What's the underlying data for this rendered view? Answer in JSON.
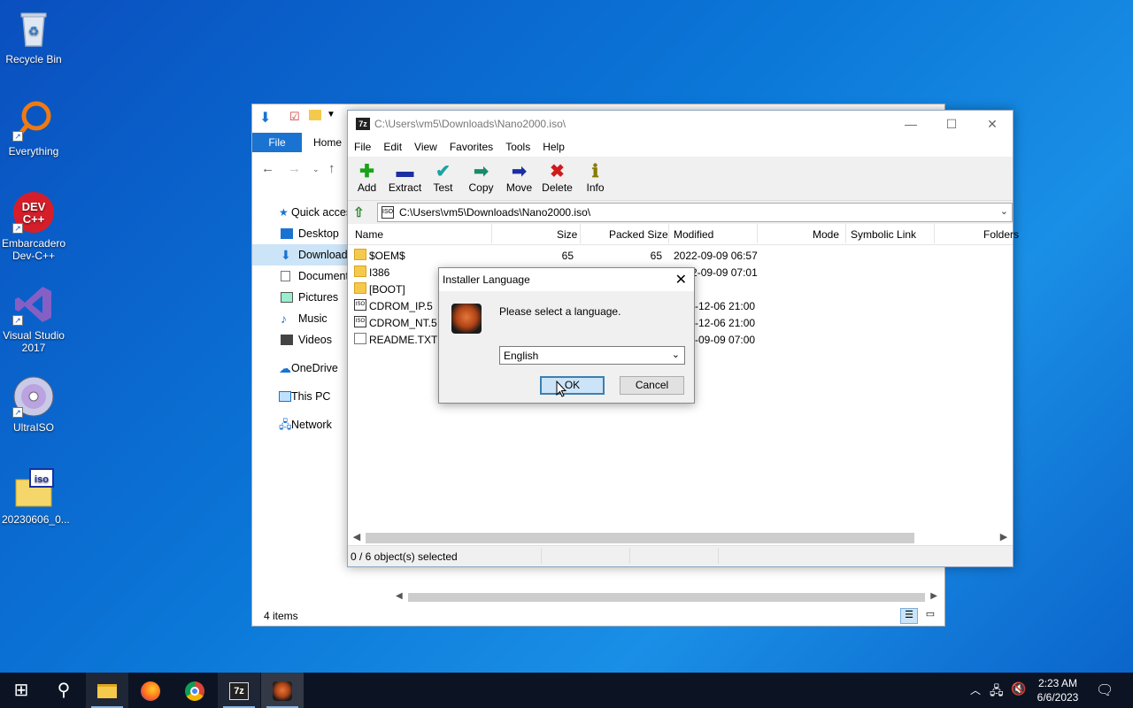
{
  "desktop": {
    "icons": [
      {
        "label": "Recycle Bin",
        "icon": "recycle-bin-icon"
      },
      {
        "label": "Everything",
        "icon": "magnifier-icon"
      },
      {
        "label": "Embarcadero Dev-C++",
        "icon": "devcpp-icon",
        "badge": "DEV C++"
      },
      {
        "label": "Visual Studio 2017",
        "icon": "visual-studio-icon"
      },
      {
        "label": "UltraISO",
        "icon": "disc-icon"
      },
      {
        "label": "20230606_0...",
        "icon": "iso-file-icon",
        "badge": "iso"
      }
    ]
  },
  "explorer": {
    "file_tab": "File",
    "home_tab": "Home",
    "sidebar": [
      {
        "label": "Quick access"
      },
      {
        "label": "Desktop"
      },
      {
        "label": "Downloads"
      },
      {
        "label": "Documents"
      },
      {
        "label": "Pictures"
      },
      {
        "label": "Music"
      },
      {
        "label": "Videos"
      },
      {
        "label": "OneDrive"
      },
      {
        "label": "This PC"
      },
      {
        "label": "Network"
      }
    ],
    "status": "4 items"
  },
  "sevenzip": {
    "logo": "7z",
    "title": "C:\\Users\\vm5\\Downloads\\Nano2000.iso\\",
    "menu": [
      "File",
      "Edit",
      "View",
      "Favorites",
      "Tools",
      "Help"
    ],
    "toolbar": [
      {
        "label": "Add",
        "glyph": "✚",
        "color": "#1aa31a"
      },
      {
        "label": "Extract",
        "glyph": "▬",
        "color": "#1b2fa3"
      },
      {
        "label": "Test",
        "glyph": "✔",
        "color": "#1aa3a3"
      },
      {
        "label": "Copy",
        "glyph": "➡",
        "color": "#1a8a6a"
      },
      {
        "label": "Move",
        "glyph": "➡",
        "color": "#1b2fa3"
      },
      {
        "label": "Delete",
        "glyph": "✖",
        "color": "#d11a1a"
      },
      {
        "label": "Info",
        "glyph": "ℹ",
        "color": "#8a7a00"
      }
    ],
    "address": "C:\\Users\\vm5\\Downloads\\Nano2000.iso\\",
    "columns": {
      "name": "Name",
      "size": "Size",
      "packed": "Packed Size",
      "modified": "Modified",
      "mode": "Mode",
      "symlink": "Symbolic Link",
      "folders": "Folders"
    },
    "files": [
      {
        "name": "$OEM$",
        "type": "folder",
        "size": "65",
        "packed": "65",
        "modified": "2022-09-09 06:57"
      },
      {
        "name": "I386",
        "type": "folder",
        "size": "",
        "packed": "",
        "modified": "2022-09-09 07:01"
      },
      {
        "name": "[BOOT]",
        "type": "folder",
        "size": "",
        "packed": "",
        "modified": ""
      },
      {
        "name": "CDROM_IP.5",
        "type": "iso",
        "size": "",
        "packed": "",
        "modified": "-12-06 21:00"
      },
      {
        "name": "CDROM_NT.5",
        "type": "iso",
        "size": "",
        "packed": "",
        "modified": "-12-06 21:00"
      },
      {
        "name": "README.TXT",
        "type": "txt",
        "size": "",
        "packed": "",
        "modified": "-09-09 07:00"
      }
    ],
    "status": "0 / 6 object(s) selected"
  },
  "dialog": {
    "title": "Installer Language",
    "message": "Please select a language.",
    "selected_language": "English",
    "ok_label": "OK",
    "cancel_label": "Cancel"
  },
  "taskbar": {
    "apps": [
      {
        "name": "start",
        "glyph": "⊞"
      },
      {
        "name": "search",
        "glyph": "⚲"
      },
      {
        "name": "file-explorer",
        "glyph": "▬"
      },
      {
        "name": "firefox",
        "glyph": "●"
      },
      {
        "name": "chrome",
        "glyph": "◉"
      },
      {
        "name": "7zip",
        "glyph": "7z"
      },
      {
        "name": "installer",
        "glyph": "●"
      }
    ],
    "time": "2:23 AM",
    "date": "6/6/2023"
  }
}
